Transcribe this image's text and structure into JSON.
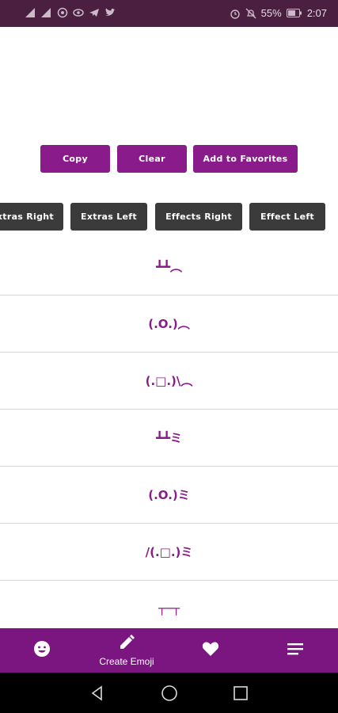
{
  "status_bar": {
    "battery_percent": "55%",
    "time": "2:07",
    "icons_left": [
      "signal-icon",
      "signal-icon",
      "nfc-icon",
      "eye-icon",
      "telegram-icon",
      "twitter-icon"
    ],
    "icons_right": [
      "alarm-icon",
      "mute-icon",
      "battery-icon"
    ]
  },
  "actions": {
    "copy_label": "Copy",
    "clear_label": "Clear",
    "favorites_label": "Add to Favorites"
  },
  "categories": [
    {
      "label": "Extras Right"
    },
    {
      "label": "Extras Left"
    },
    {
      "label": "Effects Right"
    },
    {
      "label": "Effect Left"
    }
  ],
  "emoji_list": [
    {
      "text": "┻┻︵"
    },
    {
      "text": "(.O.)︵"
    },
    {
      "text": "(.□.)\\︵"
    },
    {
      "text": "┻┻ミ"
    },
    {
      "text": "(.O.)ミ"
    },
    {
      "text": "/(.□.)ミ"
    },
    {
      "text": "┬─┬"
    }
  ],
  "bottom_nav": {
    "create_label": "Create Emoji",
    "items": [
      "smiley-icon",
      "pencil-icon",
      "heart-icon",
      "menu-icon"
    ]
  },
  "colors": {
    "accent": "#8a1b8a",
    "nav_bg": "#7b1680",
    "chip_bg": "#3b3b3b",
    "status_bg": "#4a1f3f"
  }
}
